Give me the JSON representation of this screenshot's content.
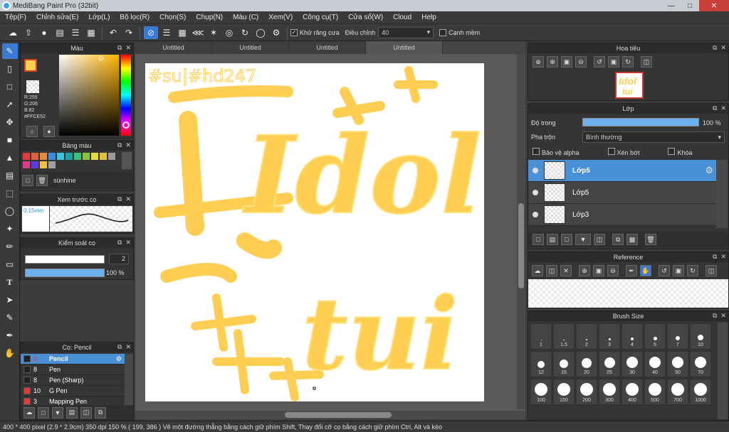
{
  "app": {
    "title": "MediBang Paint Pro (32bit)"
  },
  "menu": [
    "Tệp(F)",
    "Chỉnh sửa(E)",
    "Lớp(L)",
    "Bộ lọc(R)",
    "Chọn(S)",
    "Chụp(N)",
    "Màu (C)",
    "Xem(V)",
    "Công cụ(T)",
    "Cửa sổ(W)",
    "Cloud",
    "Help"
  ],
  "toolbar": {
    "antialias_label": "Khử răng cưa",
    "adjust_label": "Điều chỉnh",
    "adjust_value": "40",
    "edge_label": "Cạnh mềm"
  },
  "tabs": [
    "Untitled",
    "Untitled",
    "Untitled",
    "Untitled"
  ],
  "color_panel": {
    "title": "Màu",
    "r": "R:255",
    "g": "G:206",
    "b": "B:82",
    "hex": "#FFCE52",
    "fg_color": "#FFCE52"
  },
  "palette_panel": {
    "title": "Bảng màu",
    "name": "súnhine",
    "colors": [
      "#e03c3c",
      "#e0603c",
      "#e08c3c",
      "#3c8ce0",
      "#3cc0e0",
      "#20a0a0",
      "#3cc07c",
      "#8cc03c",
      "#e0e03c",
      "#e0c03c",
      "#9a9a9a",
      "#e03c8c",
      "#5a3ce0",
      "#f0c040",
      "#a0a0a0"
    ]
  },
  "preview_panel": {
    "title": "Xem trước cọ",
    "size": "0.15mm"
  },
  "brush_control": {
    "title": "Kiểm soát cọ",
    "size": "2",
    "opacity": "100 %",
    "opacity_level": 1.0
  },
  "brush_list": {
    "title": "Cọ: Pencil",
    "items": [
      {
        "num": "2",
        "name": "Pencil",
        "color": "#222222"
      },
      {
        "num": "8",
        "name": "Pen",
        "color": "#222222"
      },
      {
        "num": "8",
        "name": "Pen (Sharp)",
        "color": "#222222"
      },
      {
        "num": "10",
        "name": "G Pen",
        "color": "#e03c3c"
      },
      {
        "num": "3",
        "name": "Mapping Pen",
        "color": "#e03c3c"
      }
    ]
  },
  "navigator": {
    "title": "Hoa tiêu"
  },
  "layer_panel": {
    "title": "Lớp",
    "opacity_label": "Độ trong",
    "opacity_value": "100 %",
    "opacity_level": 1.0,
    "blend_label": "Pha trộn",
    "blend_value": "Bình thường",
    "protect_alpha": "Bảo vệ alpha",
    "clipping": "Xén bớt",
    "lock": "Khóa",
    "layers": [
      "Lớp5",
      "Lớp5",
      "Lớp3"
    ]
  },
  "reference_panel": {
    "title": "Reference"
  },
  "brush_size_panel": {
    "title": "Brush Size",
    "sizes": [
      "1",
      "1.5",
      "2",
      "3",
      "4",
      "5",
      "7",
      "10",
      "12",
      "15",
      "20",
      "25",
      "30",
      "40",
      "50",
      "70",
      "100",
      "150",
      "200",
      "300",
      "400",
      "500",
      "700",
      "1000"
    ]
  },
  "status": {
    "text": "400 * 400 pixel  (2.9 * 2.9cm)  350 dpi  150 %  ( 199, 386 )  Vẽ một đường thẳng bằng cách giữ phím Shift, Thay đổi cỡ cọ bằng cách giữ phím Ctrl, Alt và kéo"
  },
  "canvas": {
    "hashtag": "#su|#hd247",
    "word1": "Idol",
    "word2": "tui"
  }
}
